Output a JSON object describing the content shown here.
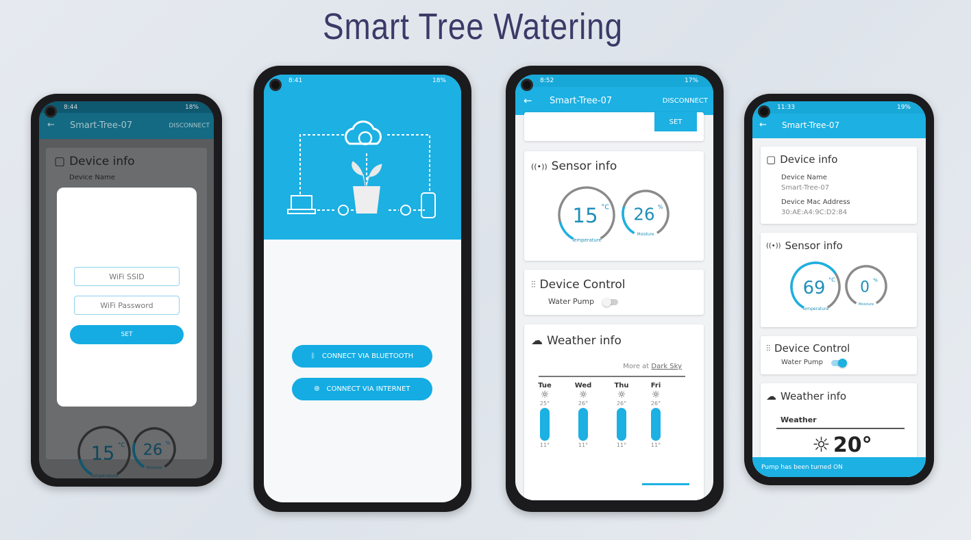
{
  "title": "Smart Tree Watering",
  "colors": {
    "primary": "#1cb0e3",
    "title": "#3b3a68",
    "track": "#888888"
  },
  "app": {
    "device_title": "Smart-Tree-07",
    "disconnect": "DISCONNECT",
    "back_icon": "arrow-left-icon"
  },
  "phone1": {
    "time": "8:44",
    "battery": "18%",
    "device_info_title": "Device info",
    "device_name_label": "Device Name",
    "dialog": {
      "ssid_placeholder": "WiFi SSID",
      "password_placeholder": "WiFi Password",
      "set": "SET"
    },
    "temperature": {
      "value": "15",
      "unit": "°C",
      "label": "Temperature",
      "fraction": 0.15
    },
    "moisture": {
      "value": "26",
      "unit": "%",
      "label": "Moisture",
      "fraction": 0.26
    }
  },
  "phone2": {
    "time": "8:41",
    "battery": "18%",
    "connect_bluetooth": "CONNECT VIA BLUETOOTH",
    "connect_internet": "CONNECT VIA INTERNET"
  },
  "phone3": {
    "time": "8:52",
    "battery": "17%",
    "set": "SET",
    "sensor_title": "Sensor info",
    "temperature": {
      "value": "15",
      "unit": "°C",
      "label": "Temperature",
      "fraction": 0.15
    },
    "moisture": {
      "value": "26",
      "unit": "%",
      "label": "Moisture",
      "fraction": 0.26
    },
    "control_title": "Device Control",
    "water_pump": "Water Pump",
    "pump_on": false,
    "weather_title": "Weather info",
    "more_at": "More at ",
    "dark_sky": "Dark Sky",
    "forecast": [
      {
        "day": "Tue",
        "high": "25°",
        "low": "11°"
      },
      {
        "day": "Wed",
        "high": "26°",
        "low": "11°"
      },
      {
        "day": "Thu",
        "high": "26°",
        "low": "11°"
      },
      {
        "day": "Fri",
        "high": "26°",
        "low": "11°"
      }
    ]
  },
  "phone4": {
    "time": "11:33",
    "battery": "19%",
    "device_info_title": "Device info",
    "device_name_label": "Device Name",
    "device_name": "Smart-Tree-07",
    "mac_label": "Device Mac Address",
    "mac": "30:AE:A4:9C:D2:84",
    "sensor_title": "Sensor info",
    "temperature": {
      "value": "69",
      "unit": "°C",
      "label": "Temperature",
      "fraction": 0.69
    },
    "moisture": {
      "value": "0",
      "unit": "%",
      "label": "Moisture",
      "fraction": 0.0
    },
    "control_title": "Device Control",
    "water_pump": "Water Pump",
    "pump_on": true,
    "weather_title": "Weather info",
    "weather_label": "Weather",
    "current_temp": "20°",
    "snackbar": "Pump has been turned ON"
  }
}
